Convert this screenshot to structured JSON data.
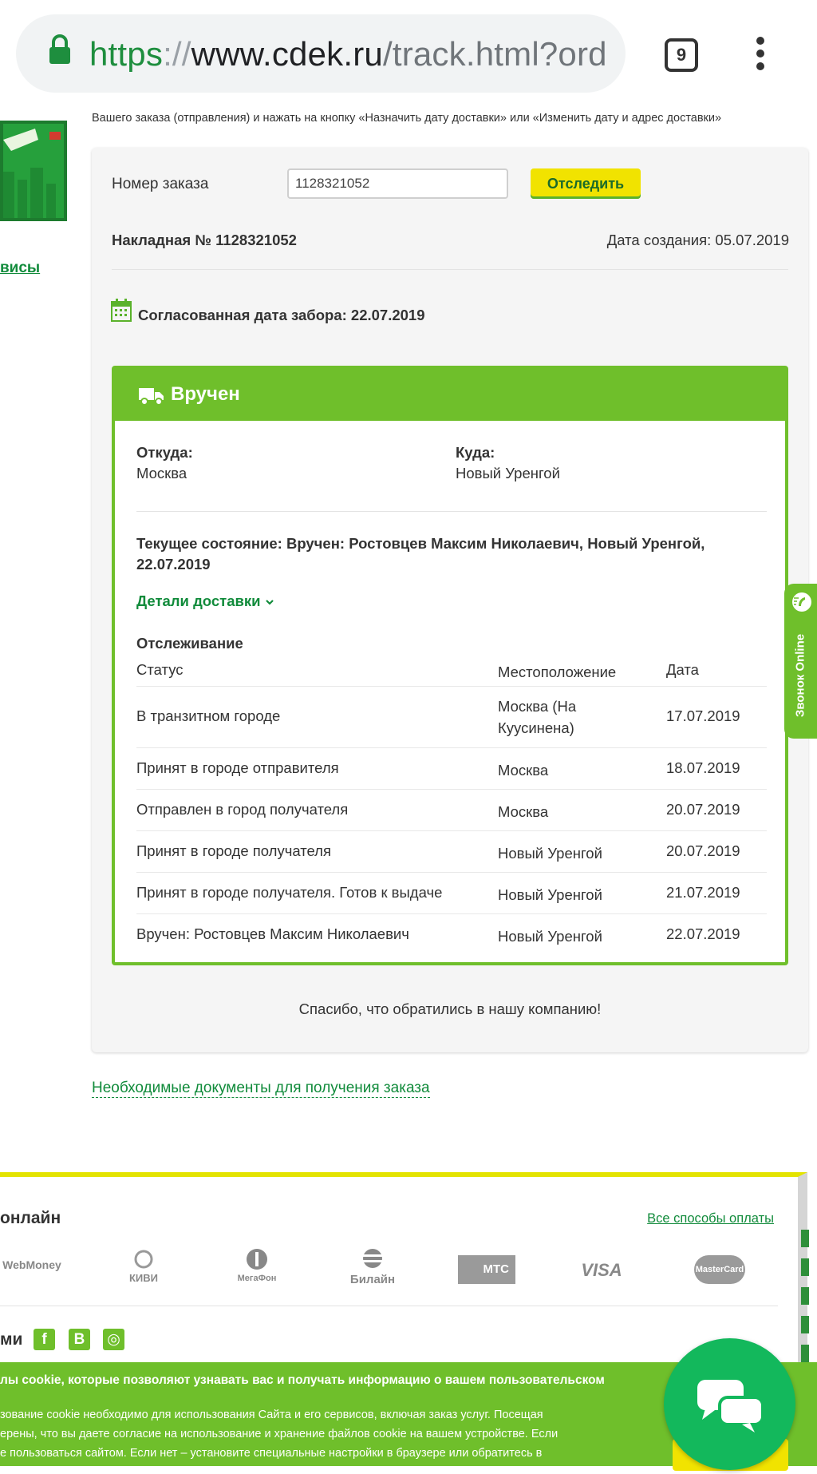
{
  "browser": {
    "url_https": "https",
    "url_sep": "://",
    "url_host": "www.cdek.ru",
    "url_path": "/track.html?orde",
    "tab_count": "9"
  },
  "left": {
    "link": "висы"
  },
  "notice": "Вашего заказа (отправления) и нажать на кнопку «Назначить дату доставки» или «Изменить дату и адрес доставки»",
  "search": {
    "label": "Номер заказа",
    "value": "1128321052",
    "button": "Отследить"
  },
  "waybill": {
    "number": "Накладная № 1128321052",
    "created": "Дата создания: 05.07.2019",
    "pickup": "Согласованная дата забора: 22.07.2019"
  },
  "status": {
    "title": "Вручен",
    "from_label": "Откуда:",
    "from_value": "Москва",
    "to_label": "Куда:",
    "to_value": "Новый Уренгой",
    "current": "Текущее состояние: Вручен: Ростовцев Максим Николаевич, Новый Уренгой, 22.07.2019",
    "details_link": "Детали доставки",
    "tracking_title": "Отслеживание",
    "columns": [
      "Статус",
      "Местоположение",
      "Дата"
    ],
    "rows": [
      {
        "status": "В транзитном городе",
        "location": "Москва (На Куусинена)",
        "date": "17.07.2019"
      },
      {
        "status": "Принят в городе отправителя",
        "location": "Москва",
        "date": "18.07.2019"
      },
      {
        "status": "Отправлен в город получателя",
        "location": "Москва",
        "date": "20.07.2019"
      },
      {
        "status": "Принят в городе получателя",
        "location": "Новый Уренгой",
        "date": "20.07.2019"
      },
      {
        "status": "Принят в городе получателя. Готов к выдаче",
        "location": "Новый Уренгой",
        "date": "21.07.2019"
      },
      {
        "status": "Вручен: Ростовцев Максим Николаевич",
        "location": "Новый Уренгой",
        "date": "22.07.2019"
      }
    ],
    "thanks": "Спасибо, что обратились в нашу компанию!"
  },
  "docs_link": "Необходимые документы для получения заказа",
  "side_tab": {
    "label": "Звонок Online"
  },
  "payment": {
    "title": "онлайн",
    "all_link": "Все способы оплаты",
    "logos": [
      "WebMoney",
      "КИВИ",
      "МегаФон",
      "Билайн",
      "МТС",
      "VISA",
      "MasterCard"
    ],
    "social_title": "ми",
    "social": [
      "f",
      "B",
      "◎"
    ]
  },
  "cookie": {
    "title": "лы cookie, которые позволяют узнавать вас и получать информацию о вашем пользовательском",
    "line1": "зование cookie необходимо для использования Сайта и его сервисов, включая заказ услуг. Посещая",
    "line2": "ерены, что вы даете согласие на использование и хранение файлов cookie на вашем устройстве. Если",
    "line3": "е пользоваться сайтом. Если нет – установите специальные настройки в браузере или обратитесь в"
  },
  "colors": {
    "brand_green": "#6fbf2b",
    "link_green": "#118b3b",
    "accent_yellow": "#f1e300",
    "chat_green": "#13b85c"
  }
}
